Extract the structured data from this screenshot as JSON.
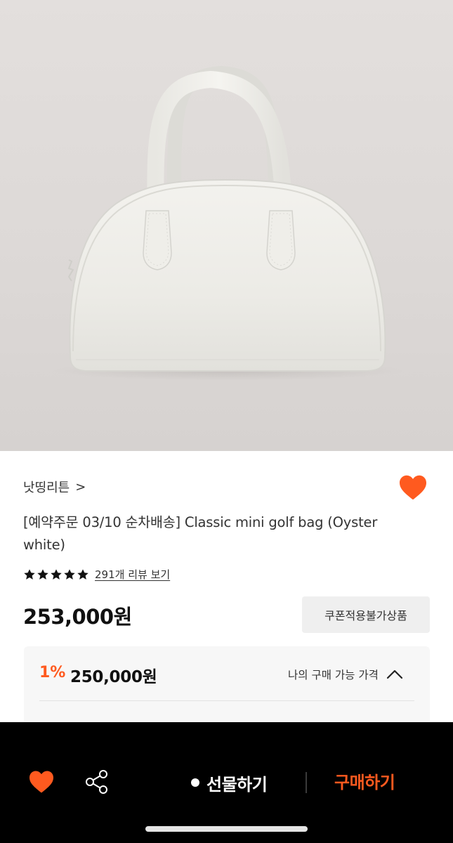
{
  "product": {
    "image_alt": "product-photo-white-mini-golf-bag",
    "brand_label": "낫띵리튼",
    "brand_chevron": ">",
    "title": "[예약주문 03/10 순차배송] Classic mini golf bag (Oyster white)",
    "rating_stars": 5,
    "review_link": "291개 리뷰 보기",
    "price": "253,000원",
    "coupon_badge": "쿠폰적용불가상품"
  },
  "best_price": {
    "discount": "1%",
    "amount": "250,000원",
    "label": "나의 구매 가능 가격"
  },
  "bottom_bar": {
    "like_icon": "heart-icon",
    "share_icon": "share-icon",
    "gift_label": "선물하기",
    "buy_label": "구매하기"
  },
  "colors": {
    "accent": "#ff5a1f",
    "bottom_bar_bg": "#000000",
    "badge_bg": "#efefef"
  }
}
